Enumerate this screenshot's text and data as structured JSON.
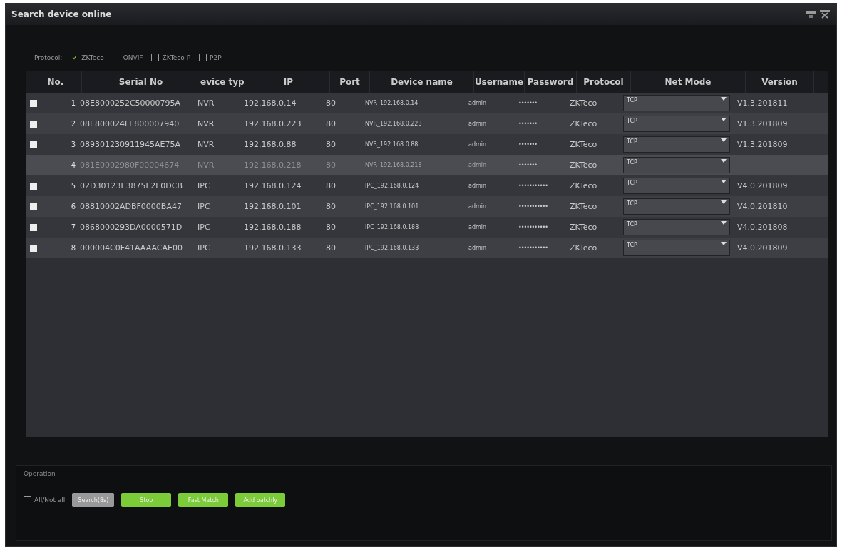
{
  "window": {
    "title": "Search device online"
  },
  "protocol_filter": {
    "label": "Protocol:",
    "options": [
      {
        "label": "ZKTeco",
        "checked": true
      },
      {
        "label": "ONVIF",
        "checked": false
      },
      {
        "label": "ZKTeco P",
        "checked": false
      },
      {
        "label": "P2P",
        "checked": false
      }
    ]
  },
  "table": {
    "columns": [
      "No.",
      "Serial No",
      "evice typ",
      "IP",
      "Port",
      "Device name",
      "Username",
      "Password",
      "Protocol",
      "Net Mode",
      "Version"
    ],
    "rows": [
      {
        "no": "1",
        "disabled": false,
        "checked": false,
        "serial": "08E8000252C50000795A",
        "type": "NVR",
        "ip": "192.168.0.14",
        "port": "80",
        "name": "NVR_192.168.0.14",
        "username": "admin",
        "password": "•••••••",
        "protocol": "ZKTeco",
        "net_mode": "TCP",
        "version": "V1.3.201811"
      },
      {
        "no": "2",
        "disabled": false,
        "checked": false,
        "serial": "08E800024FE800007940",
        "type": "NVR",
        "ip": "192.168.0.223",
        "port": "80",
        "name": "NVR_192.168.0.223",
        "username": "admin",
        "password": "•••••••",
        "protocol": "ZKTeco",
        "net_mode": "TCP",
        "version": "V1.3.201809"
      },
      {
        "no": "3",
        "disabled": false,
        "checked": false,
        "serial": "089301230911945AE75A",
        "type": "NVR",
        "ip": "192.168.0.88",
        "port": "80",
        "name": "NVR_192.168.0.88",
        "username": "admin",
        "password": "•••••••",
        "protocol": "ZKTeco",
        "net_mode": "TCP",
        "version": "V1.3.201809"
      },
      {
        "no": "4",
        "disabled": true,
        "serial": "081E0002980F00004674",
        "type": "NVR",
        "ip": "192.168.0.218",
        "port": "80",
        "name": "NVR_192.168.0.218",
        "username": "admin",
        "password": "•••••••",
        "protocol": "ZKTeco",
        "net_mode": "TCP"
      },
      {
        "no": "5",
        "disabled": false,
        "checked": false,
        "serial": "02D30123E3875E2E0DCB",
        "type": "IPC",
        "ip": "192.168.0.124",
        "port": "80",
        "name": "IPC_192.168.0.124",
        "username": "admin",
        "password": "•••••••••••",
        "protocol": "ZKTeco",
        "net_mode": "TCP",
        "version": "V4.0.201809"
      },
      {
        "no": "6",
        "disabled": false,
        "checked": false,
        "serial": "08810002ADBF0000BA47",
        "type": "IPC",
        "ip": "192.168.0.101",
        "port": "80",
        "name": "IPC_192.168.0.101",
        "username": "admin",
        "password": "•••••••••••",
        "protocol": "ZKTeco",
        "net_mode": "TCP",
        "version": "V4.0.201810"
      },
      {
        "no": "7",
        "disabled": false,
        "checked": false,
        "serial": "0868000293DA0000571D",
        "type": "IPC",
        "ip": "192.168.0.188",
        "port": "80",
        "name": "IPC_192.168.0.188",
        "username": "admin",
        "password": "•••••••••••",
        "protocol": "ZKTeco",
        "net_mode": "TCP",
        "version": "V4.0.201808"
      },
      {
        "no": "8",
        "disabled": false,
        "checked": false,
        "serial": "000004C0F41AAAACAE00",
        "type": "IPC",
        "ip": "192.168.0.133",
        "port": "80",
        "name": "IPC_192.168.0.133",
        "username": "admin",
        "password": "•••••••••••",
        "protocol": "ZKTeco",
        "net_mode": "TCP",
        "version": "V4.0.201809"
      }
    ]
  },
  "operation": {
    "title": "Operation",
    "select_all": {
      "label": "All/Not all",
      "checked": false
    },
    "buttons": [
      {
        "label": "Search(8s)",
        "kind": "grey"
      },
      {
        "label": "Stop",
        "kind": "green"
      },
      {
        "label": "Fast Match",
        "kind": "green"
      },
      {
        "label": "Add batchly",
        "kind": "green"
      }
    ]
  }
}
